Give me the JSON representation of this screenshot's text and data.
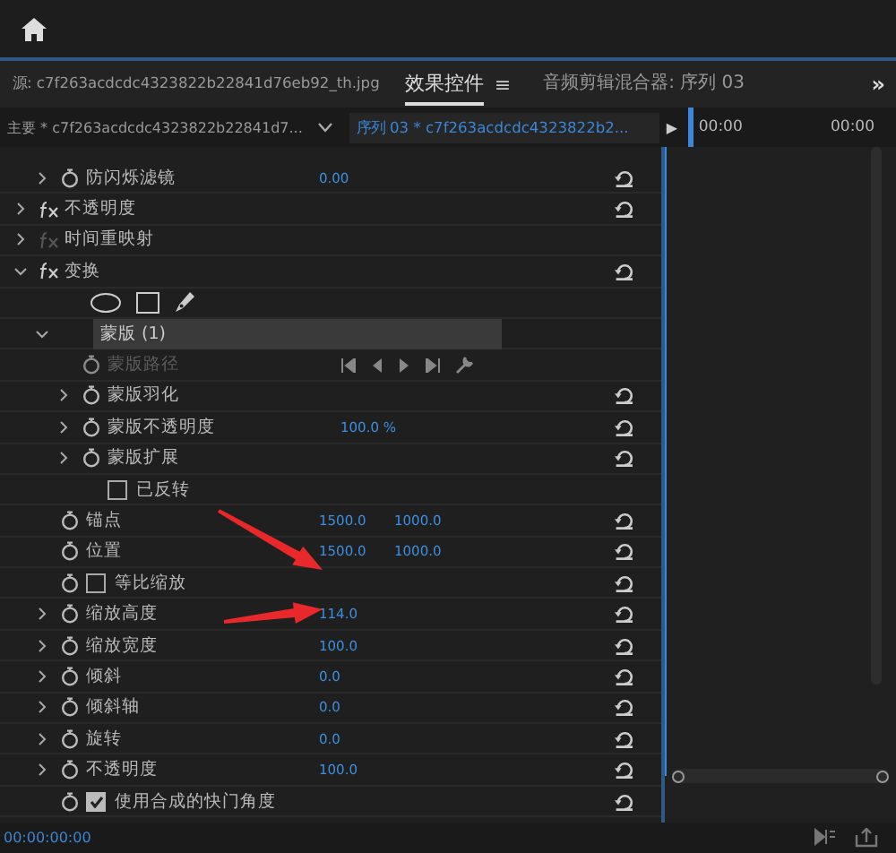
{
  "panel_tabs": [
    {
      "label": "源: c7f263acdcdc4323822b22841d76eb92_th.jpg",
      "selected": false
    },
    {
      "label": "效果控件",
      "selected": true,
      "menu": "≡"
    },
    {
      "label": "音频剪辑混合器: 序列 03",
      "selected": false
    }
  ],
  "overflow": "»",
  "clip_bar": {
    "master": "主要 * c7f263acdcdc4323822b22841d7...",
    "sequence": "序列 03 * c7f263acdcdc4323822b2...",
    "play": "▶",
    "time_start": "00:00",
    "time_end": "00:00"
  },
  "previous_rows": [
    {
      "kind": "property",
      "label": "防闪烁滤镜",
      "expanded": false,
      "values": [
        "0.00"
      ],
      "reset": true
    }
  ],
  "rows": [
    {
      "kind": "effect",
      "label": "不透明度",
      "expanded": false,
      "fx_enabled": true,
      "reset": true
    },
    {
      "kind": "effect",
      "label": "时间重映射",
      "expanded": false,
      "fx_enabled": false,
      "reset": false
    },
    {
      "kind": "effect",
      "label": "变换",
      "expanded": true,
      "fx_enabled": true,
      "reset": true,
      "children": [
        {
          "kind": "shapes"
        },
        {
          "kind": "mask",
          "label": "蒙版 (1)",
          "expanded": true,
          "children": [
            {
              "kind": "keyframes",
              "label": "蒙版路径"
            },
            {
              "kind": "property",
              "label": "蒙版羽化",
              "expanded": false,
              "reset": true
            },
            {
              "kind": "property",
              "label": "蒙版不透明度",
              "expanded": false,
              "values": [
                "100.0 %"
              ],
              "reset": true
            },
            {
              "kind": "property",
              "label": "蒙版扩展",
              "expanded": false,
              "reset": true
            },
            {
              "kind": "checkbox",
              "label": "已反转",
              "checked": false,
              "stopwatch": false,
              "reset": false
            }
          ]
        },
        {
          "kind": "property",
          "label": "锚点",
          "values": [
            "1500.0",
            "1000.0"
          ],
          "reset": true
        },
        {
          "kind": "property",
          "label": "位置",
          "values": [
            "1500.0",
            "1000.0"
          ],
          "reset": true
        },
        {
          "kind": "checkbox",
          "label": "等比缩放",
          "checked": false,
          "stopwatch": true,
          "reset": true
        },
        {
          "kind": "property",
          "label": "缩放高度",
          "expanded": false,
          "values": [
            "114.0"
          ],
          "reset": true
        },
        {
          "kind": "property",
          "label": "缩放宽度",
          "expanded": false,
          "values": [
            "100.0"
          ],
          "reset": true
        },
        {
          "kind": "property",
          "label": "倾斜",
          "expanded": false,
          "values": [
            "0.0"
          ],
          "reset": true
        },
        {
          "kind": "property",
          "label": "倾斜轴",
          "expanded": false,
          "values": [
            "0.0"
          ],
          "reset": true
        },
        {
          "kind": "property",
          "label": "旋转",
          "expanded": false,
          "values": [
            "0.0"
          ],
          "reset": true
        },
        {
          "kind": "property",
          "label": "不透明度",
          "expanded": false,
          "values": [
            "100.0"
          ],
          "reset": true
        },
        {
          "kind": "checkbox",
          "label": "使用合成的快门角度",
          "checked": true,
          "stopwatch": true,
          "reset": true
        }
      ]
    }
  ],
  "annotations": [
    {
      "kind": "arrow"
    },
    {
      "kind": "arrow"
    }
  ],
  "status_bar": {
    "timecode": "00:00:00:00"
  }
}
